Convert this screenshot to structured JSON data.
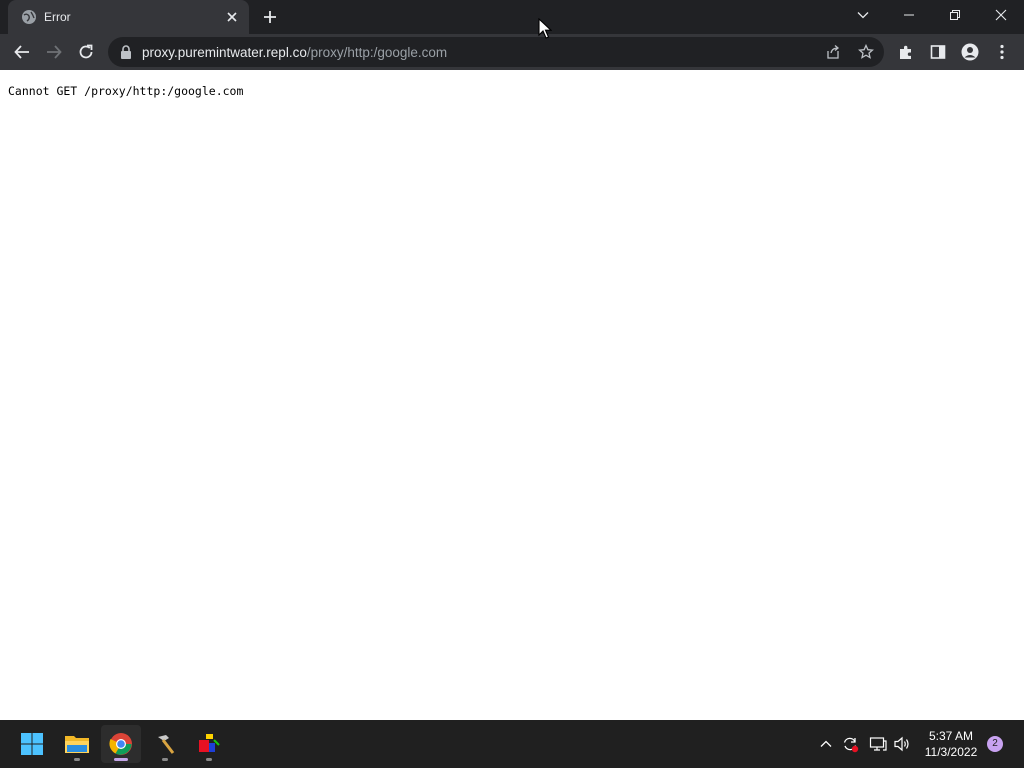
{
  "browser": {
    "tab": {
      "title": "Error",
      "favicon": "globe-icon"
    },
    "omnibox": {
      "host": "proxy.puremintwater.repl.co",
      "path": "/proxy/http:/google.com"
    }
  },
  "page": {
    "error_text": "Cannot GET /proxy/http:/google.com"
  },
  "taskbar": {
    "apps": [
      "windows-start",
      "file-explorer",
      "chrome",
      "hammer-tool",
      "paint-app"
    ],
    "clock": {
      "time": "5:37 AM",
      "date": "11/3/2022"
    },
    "notifications": "2"
  },
  "colors": {
    "tab_strip": "#202124",
    "toolbar": "#35363a",
    "taskbar": "#202020",
    "accent": "#c8a2f0"
  }
}
